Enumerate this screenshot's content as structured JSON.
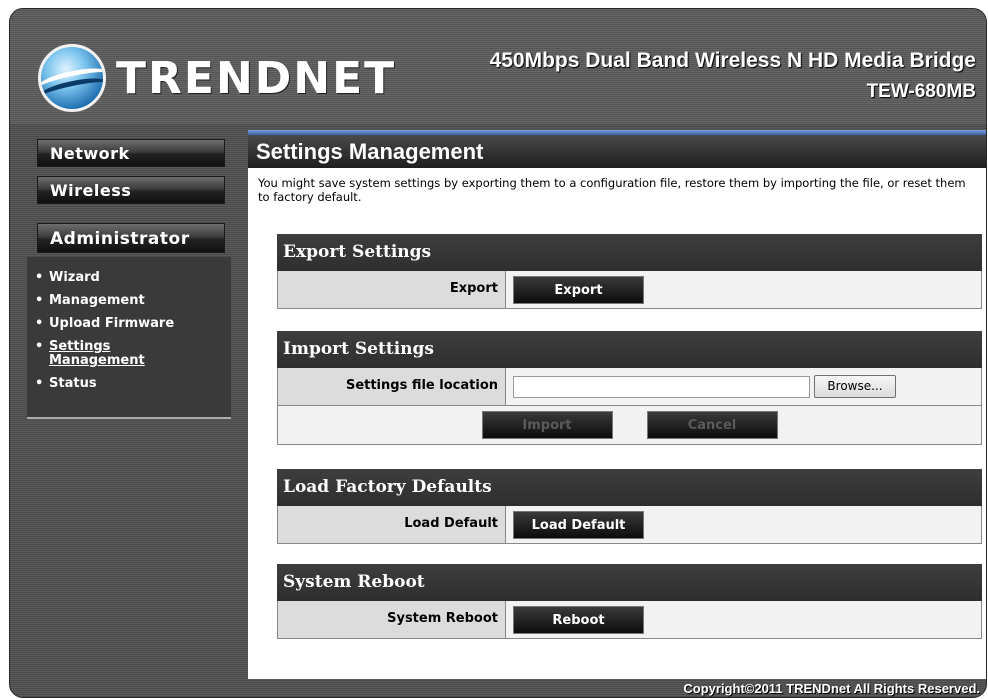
{
  "brand": {
    "name": "TRENDNET"
  },
  "product": {
    "title": "450Mbps Dual Band Wireless N HD Media Bridge",
    "model": "TEW-680MB"
  },
  "nav": {
    "network": "Network",
    "wireless": "Wireless",
    "administrator": "Administrator",
    "items": [
      {
        "label": "Wizard"
      },
      {
        "label": "Management"
      },
      {
        "label": "Upload Firmware"
      },
      {
        "label": "Settings Management",
        "active": true
      },
      {
        "label": "Status"
      }
    ]
  },
  "page": {
    "title": "Settings Management",
    "intro": "You might save system settings by exporting them to a configuration file, restore them by importing the file, or reset them to factory default."
  },
  "export": {
    "title": "Export Settings",
    "label": "Export",
    "button": "Export"
  },
  "import": {
    "title": "Import Settings",
    "label": "Settings file location",
    "file_value": "",
    "browse": "Browse...",
    "import_button": "Import",
    "cancel_button": "Cancel"
  },
  "factory": {
    "title": "Load Factory Defaults",
    "label": "Load Default",
    "button": "Load Default"
  },
  "reboot": {
    "title": "System Reboot",
    "label": "System Reboot",
    "button": "Reboot"
  },
  "footer": {
    "copyright": "Copyright©2011 TRENDnet All Rights Reserved."
  },
  "colors": {
    "accent_bar": "#3a5fa8",
    "frame": "#4a4a4a"
  }
}
